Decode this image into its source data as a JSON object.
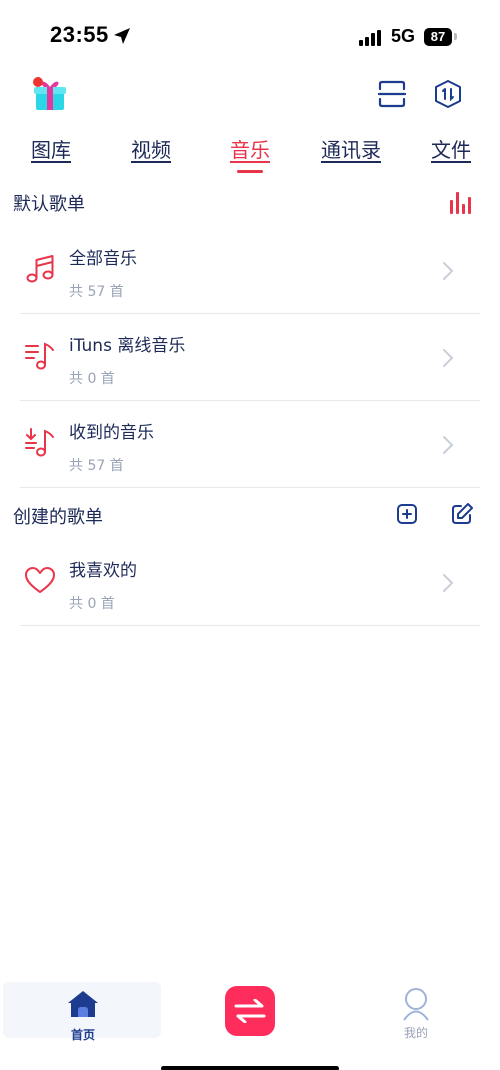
{
  "status_bar": {
    "time": "23:55",
    "network": "5G",
    "battery": "87"
  },
  "tabs": [
    {
      "label": "图库"
    },
    {
      "label": "视频"
    },
    {
      "label": "音乐",
      "active": true
    },
    {
      "label": "通讯录"
    },
    {
      "label": "文件"
    }
  ],
  "default_section": {
    "title": "默认歌单",
    "items": [
      {
        "title": "全部音乐",
        "count": "共 57 首",
        "icon": "music-note-icon"
      },
      {
        "title": "iTuns 离线音乐",
        "count": "共 0 首",
        "icon": "playlist-icon"
      },
      {
        "title": "收到的音乐",
        "count": "共 57 首",
        "icon": "received-music-icon"
      }
    ]
  },
  "created_section": {
    "title": "创建的歌单",
    "items": [
      {
        "title": "我喜欢的",
        "count": "共 0 首",
        "icon": "heart-icon"
      }
    ]
  },
  "bottom_nav": {
    "home_label": "首页",
    "mine_label": "我的"
  },
  "colors": {
    "accent": "#e8354a",
    "text": "#1d2a57",
    "secondary": "#9aa3b8",
    "transfer_button": "#ff2d5b",
    "home_active": "#1d3c8f"
  }
}
